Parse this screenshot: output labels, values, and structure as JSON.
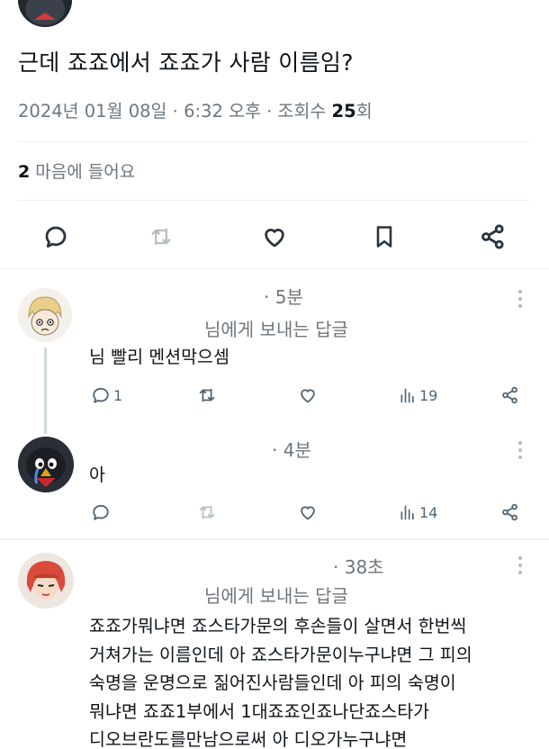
{
  "tweet": {
    "text": "근데 죠죠에서 죠죠가 사람 이름임?",
    "meta_prefix": "2024년 01월 08일 · 6:32 오후 · 조회수 ",
    "views": "25",
    "meta_suffix": "회",
    "likes_count": "2",
    "likes_label": " 마음에 들어요"
  },
  "replies": [
    {
      "time": "· 5분",
      "reply_to": "님에게 보내는 답글",
      "body": "님 빨리 멘션막으셈",
      "comments": "1",
      "views": "19"
    },
    {
      "time": "· 4분",
      "body": "아",
      "views": "14"
    },
    {
      "time": "· 38초",
      "reply_to": "님에게 보내는 답글",
      "lines": [
        "죠죠가뭐냐면 죠스타가문의 후손들이 살면서 한번씩",
        "거쳐가는 이름인데 아 죠스타가문이누구냐면 그 피의",
        "숙명을 운명으로 짊어진사람들인데 아 피의 숙명이",
        "뭐냐면 죠죠1부에서 1대죠죠인죠나단죠스타가",
        "디오브란도를만남으로써 아 디오가누구냐면"
      ]
    }
  ],
  "icons": {
    "reply": "speech-bubble-icon",
    "retweet": "retweet-icon",
    "like": "heart-icon",
    "bookmark": "bookmark-icon",
    "share": "share-icon",
    "views": "bar-chart-icon",
    "more": "more-vertical-icon"
  },
  "colors": {
    "text": "#0f1419",
    "secondary": "#6e767d",
    "icon": "#536471",
    "divider": "#eff3f4"
  }
}
